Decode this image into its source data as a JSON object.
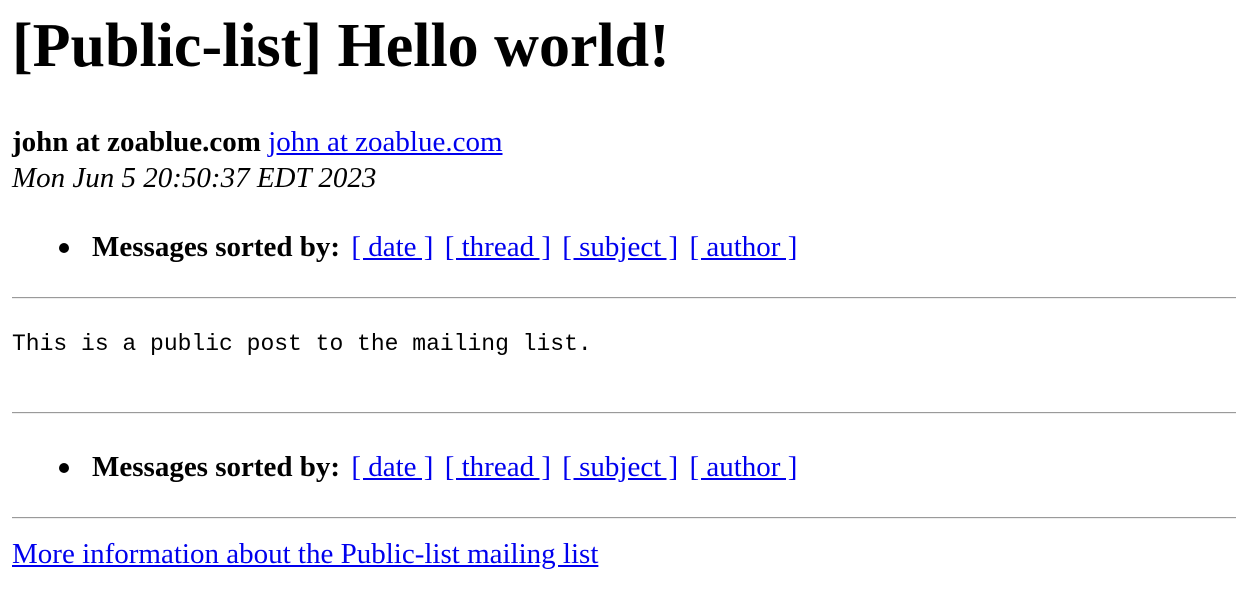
{
  "message": {
    "title": "[Public-list] Hello world!",
    "author_name": "john at zoablue.com",
    "author_link": "john at zoablue.com",
    "date": "Mon Jun 5 20:50:37 EDT 2023",
    "body": "This is a public post to the mailing list."
  },
  "nav": {
    "label": "Messages sorted by:",
    "links": [
      "[ date ]",
      "[ thread ]",
      "[ subject ]",
      "[ author ]"
    ]
  },
  "footer": {
    "more_info": "More information about the Public-list mailing list"
  },
  "colors": {
    "link": "#0000ee",
    "rule": "#9a9a9a",
    "text": "#000000",
    "background": "#ffffff"
  }
}
